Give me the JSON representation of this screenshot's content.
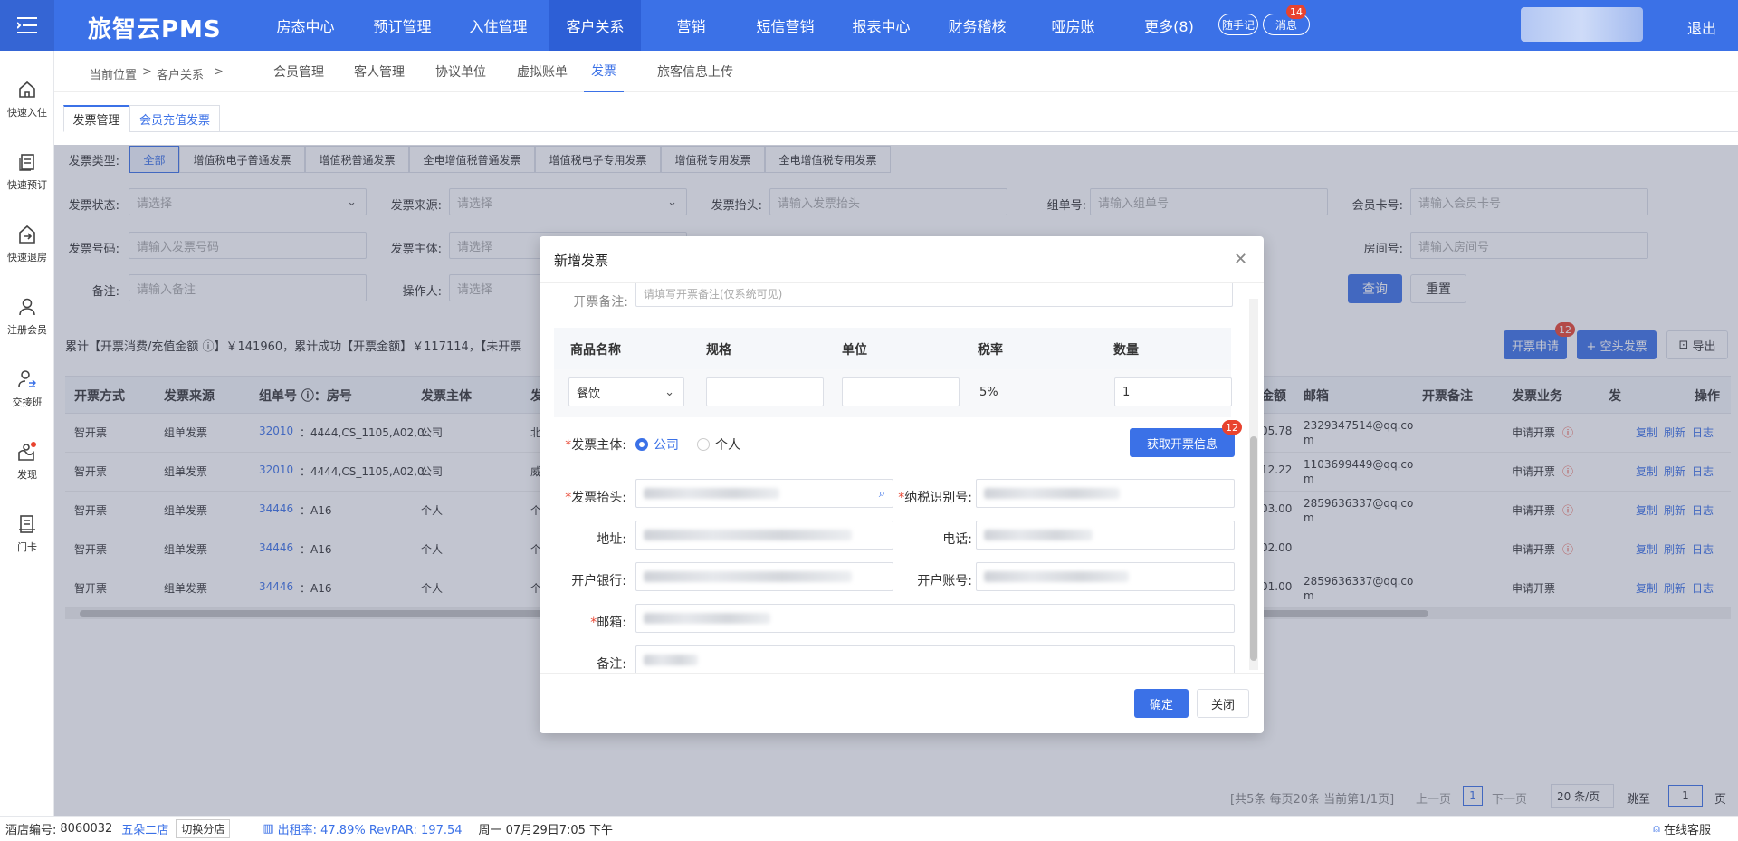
{
  "app": {
    "logo": "旅智云PMS",
    "logout": "退出"
  },
  "nav": [
    {
      "label": "房态中心"
    },
    {
      "label": "预订管理"
    },
    {
      "label": "入住管理"
    },
    {
      "label": "客户关系"
    },
    {
      "label": "营销"
    },
    {
      "label": "短信营销"
    },
    {
      "label": "报表中心"
    },
    {
      "label": "财务稽核"
    },
    {
      "label": "哑房账"
    },
    {
      "label": "更多(8)"
    }
  ],
  "header_pills": {
    "notes": "随手记",
    "messages": "消息",
    "message_count": "14"
  },
  "sidebar": [
    {
      "label": "快速入住",
      "icon": "home-icon"
    },
    {
      "label": "快速预订",
      "icon": "book-icon"
    },
    {
      "label": "快速退房",
      "icon": "checkout-icon"
    },
    {
      "label": "注册会员",
      "icon": "user-plus-icon"
    },
    {
      "label": "交接班",
      "icon": "shift-icon"
    },
    {
      "label": "发现",
      "icon": "discover-icon"
    },
    {
      "label": "门卡",
      "icon": "card-icon"
    }
  ],
  "breadcrumb": {
    "current": "当前位置",
    "sep1": ">",
    "section": "客户关系",
    "sep2": ">"
  },
  "subtabs": [
    "会员管理",
    "客人管理",
    "协议单位",
    "虚拟账单",
    "发票",
    "旅客信息上传"
  ],
  "inner_tabs": [
    "发票管理",
    "会员充值发票"
  ],
  "filters": {
    "type_label": "发票类型:",
    "types": [
      "全部",
      "增值税电子普通发票",
      "增值税普通发票",
      "全电增值税普通发票",
      "增值税电子专用发票",
      "增值税专用发票",
      "全电增值税专用发票"
    ],
    "status_label": "发票状态:",
    "status_ph": "请选择",
    "source_label": "发票来源:",
    "source_ph": "请选择",
    "title_label": "发票抬头:",
    "title_ph": "请输入发票抬头",
    "group_label": "组单号:",
    "group_ph": "请输入组单号",
    "member_label": "会员卡号:",
    "member_ph": "请输入会员卡号",
    "number_label": "发票号码:",
    "number_ph": "请输入发票号码",
    "subject_label": "发票主体:",
    "subject_ph": "请选择",
    "room_label": "房间号:",
    "room_ph": "请输入房间号",
    "remark_label": "备注:",
    "remark_ph": "请输入备注",
    "operator_label": "操作人:",
    "operator_ph": "请选择",
    "query": "查询",
    "reset": "重置"
  },
  "summary": "累计【开票消费/充值金额 ⓘ】￥141960，累计成功【开票金额】￥117114，【未开票",
  "actions": {
    "apply": "开票申请",
    "apply_count": "12",
    "blank": "+ 空头发票",
    "export": "导出"
  },
  "table": {
    "headers": [
      "开票方式",
      "发票来源",
      "组单号 ⓘ：房号",
      "发票主体",
      "发",
      "金额",
      "邮箱",
      "开票备注",
      "发票业务",
      "发",
      "操作"
    ],
    "rows": [
      {
        "method": "智开票",
        "source": "组单发票",
        "group": "32010",
        "room": "：4444,CS_1105,A02,0",
        "subject": "公司",
        "f": "北",
        "amount": "05.78",
        "email": "2329347514@qq.com",
        "remark": "",
        "biz": "申请开票",
        "ops": [
          "复制",
          "刷新",
          "日志"
        ]
      },
      {
        "method": "智开票",
        "source": "组单发票",
        "group": "32010",
        "room": "：4444,CS_1105,A02,0",
        "subject": "公司",
        "f": "威",
        "amount": "12.22",
        "email": "1103699449@qq.com",
        "remark": "",
        "biz": "申请开票",
        "ops": [
          "复制",
          "刷新",
          "日志"
        ]
      },
      {
        "method": "智开票",
        "source": "组单发票",
        "group": "34446",
        "room": "：A16",
        "subject": "个人",
        "f": "个",
        "amount": "03.00",
        "email": "2859636337@qq.com",
        "remark": "",
        "biz": "申请开票",
        "ops": [
          "复制",
          "刷新",
          "日志"
        ]
      },
      {
        "method": "智开票",
        "source": "组单发票",
        "group": "34446",
        "room": "：A16",
        "subject": "个人",
        "f": "个",
        "amount": "02.00",
        "email": "",
        "remark": "",
        "biz": "申请开票",
        "ops": [
          "复制",
          "刷新",
          "日志"
        ]
      },
      {
        "method": "智开票",
        "source": "组单发票",
        "group": "34446",
        "room": "：A16",
        "subject": "个人",
        "f": "个",
        "amount": "01.00",
        "email": "2859636337@qq.com",
        "remark": "",
        "biz": "申请开票",
        "ops": [
          "复制",
          "刷新",
          "日志"
        ]
      }
    ]
  },
  "pagination": {
    "info": "[共5条 每页20条 当前第1/1页]",
    "prev": "上一页",
    "page": "1",
    "next": "下一页",
    "size": "20 条/页",
    "jump": "跳至",
    "jump_value": "1",
    "page_unit": "页"
  },
  "modal": {
    "title": "新增发票",
    "top_label": "开票备注:",
    "top_ph": "请填写开票备注(仅系统可见)",
    "goods_headers": [
      "商品名称",
      "规格",
      "单位",
      "税率",
      "数量"
    ],
    "goods": {
      "name": "餐饮",
      "spec": "",
      "unit": "",
      "rate": "5%",
      "qty": "1"
    },
    "subject_label": "发票主体:",
    "subject_company": "公司",
    "subject_person": "个人",
    "fetch_btn": "获取开票信息",
    "fetch_count": "12",
    "title_label": "发票抬头:",
    "tax_label": "纳税识别号:",
    "address_label": "地址:",
    "phone_label": "电话:",
    "bank_label": "开户银行:",
    "account_label": "开户账号:",
    "email_label": "邮箱:",
    "remark_label": "备注:",
    "confirm": "确定",
    "close": "关闭"
  },
  "footer": {
    "hotel_label": "酒店编号:",
    "hotel_no": "8060032",
    "branch": "五朵二店",
    "switch": "切换分店",
    "occupancy": "出租率: 47.89%  RevPAR: 197.54",
    "datetime": "周一 07月29日7:05 下午",
    "support": "在线客服"
  },
  "colors": {
    "primary": "#3b71e7",
    "danger": "#e8432f"
  }
}
